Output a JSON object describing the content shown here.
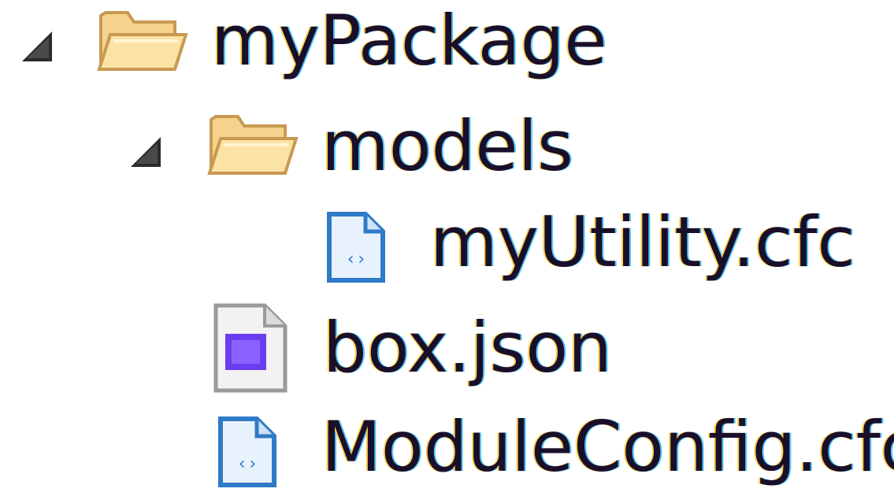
{
  "tree": {
    "root": {
      "label": "myPackage",
      "icon": "folder-open-icon",
      "expanded": true,
      "children_folder": {
        "label": "models",
        "icon": "folder-open-icon",
        "expanded": true,
        "children": [
          {
            "label": "myUtility.cfc",
            "icon": "cfc-file-icon"
          }
        ]
      },
      "files": [
        {
          "label": "box.json",
          "icon": "json-file-icon"
        },
        {
          "label": "ModuleConfig.cfc",
          "icon": "cfc-file-icon"
        }
      ]
    }
  },
  "colors": {
    "text": "#1a0f2a",
    "twisty": "#2b2b2b",
    "folder_light": "#fbe3a6",
    "folder_dark": "#c89a52",
    "cfc_border": "#2f7ac9",
    "json_fill": "#6b3df0"
  }
}
